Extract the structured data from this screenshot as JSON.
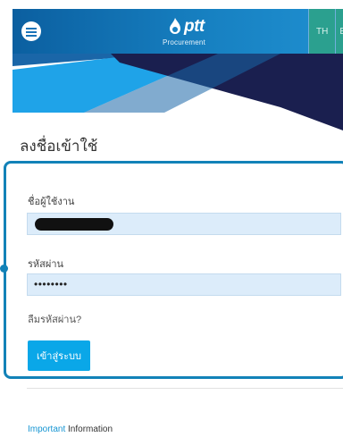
{
  "header": {
    "logo_text": "ptt",
    "logo_sub": "Procurement",
    "lang_th": "TH",
    "lang_en": "E"
  },
  "page_title": "ลงชื่อเข้าใช้",
  "form": {
    "username_label": "ชื่อผู้ใช้งาน",
    "username_value": "",
    "password_label": "รหัสผ่าน",
    "password_value": "••••••••",
    "forgot_link": "ลืมรหัสผ่าน?",
    "submit_label": "เข้าสู่ระบบ"
  },
  "info": {
    "accent": "Important",
    "rest": " Information"
  },
  "colors": {
    "header": "#1781c2",
    "card_border": "#1282b8",
    "button": "#0aa7e8",
    "input_bg": "#dcecfa"
  }
}
